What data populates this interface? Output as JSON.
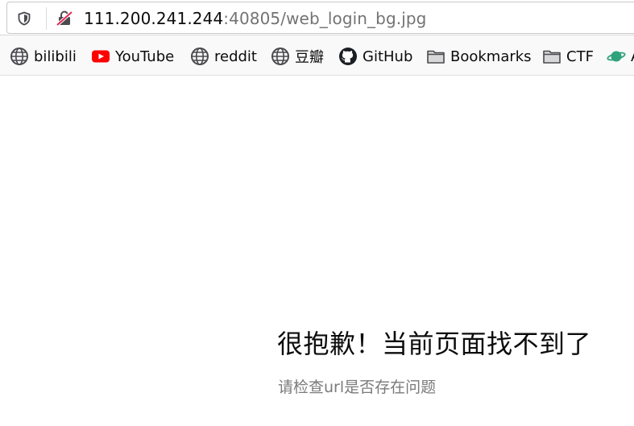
{
  "address_bar": {
    "host": "111.200.241.244",
    "rest": ":40805/web_login_bg.jpg"
  },
  "bookmarks": [
    {
      "label": "bilibili",
      "icon": "globe-icon"
    },
    {
      "label": "YouTube",
      "icon": "youtube-icon"
    },
    {
      "label": "reddit",
      "icon": "globe-icon"
    },
    {
      "label": "豆瓣",
      "icon": "globe-icon"
    },
    {
      "label": "GitHub",
      "icon": "github-icon"
    },
    {
      "label": "Bookmarks",
      "icon": "folder-icon"
    },
    {
      "label": "CTF",
      "icon": "folder-icon"
    },
    {
      "label": "A",
      "icon": "planet-icon"
    }
  ],
  "error": {
    "title": "很抱歉！当前页面找不到了",
    "subtitle": "请检查url是否存在问题"
  },
  "colors": {
    "youtube_red": "#ff0000",
    "planet_green": "#2fa37a",
    "lock_red": "#e22850"
  }
}
